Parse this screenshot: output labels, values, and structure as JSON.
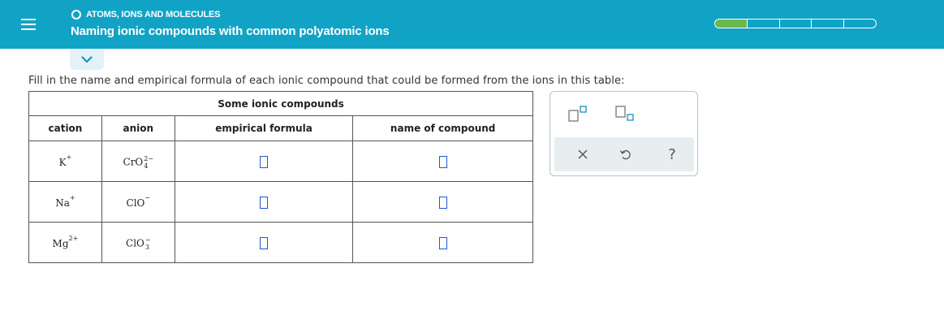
{
  "header": {
    "topic": "ATOMS, IONS AND MOLECULES",
    "title": "Naming ionic compounds with common polyatomic ions",
    "progress": {
      "segments": 5,
      "filled": 1,
      "fill_color": "#6bb84f"
    }
  },
  "instruction": "Fill in the name and empirical formula of each ionic compound that could be formed from the ions in this table:",
  "table": {
    "caption": "Some ionic compounds",
    "columns": [
      "cation",
      "anion",
      "empirical formula",
      "name of compound"
    ],
    "rows": [
      {
        "cation": {
          "symbol": "K",
          "charge": "+"
        },
        "anion": {
          "symbol": "CrO",
          "subscript": "4",
          "charge": "2−"
        }
      },
      {
        "cation": {
          "symbol": "Na",
          "charge": "+"
        },
        "anion": {
          "symbol": "ClO",
          "charge": "−"
        }
      },
      {
        "cation": {
          "symbol": "Mg",
          "charge": "2+"
        },
        "anion": {
          "symbol": "ClO",
          "subscript": "3",
          "charge": "−"
        }
      }
    ]
  },
  "palette": {
    "icons": [
      "superscript-template-icon",
      "subscript-template-icon",
      "clear-icon",
      "undo-icon",
      "help-icon"
    ],
    "help_label": "?"
  },
  "colors": {
    "header_bg": "#11a3c6",
    "answer_box": "#1f56d8",
    "palette_actions_bg": "#e8edf0"
  }
}
